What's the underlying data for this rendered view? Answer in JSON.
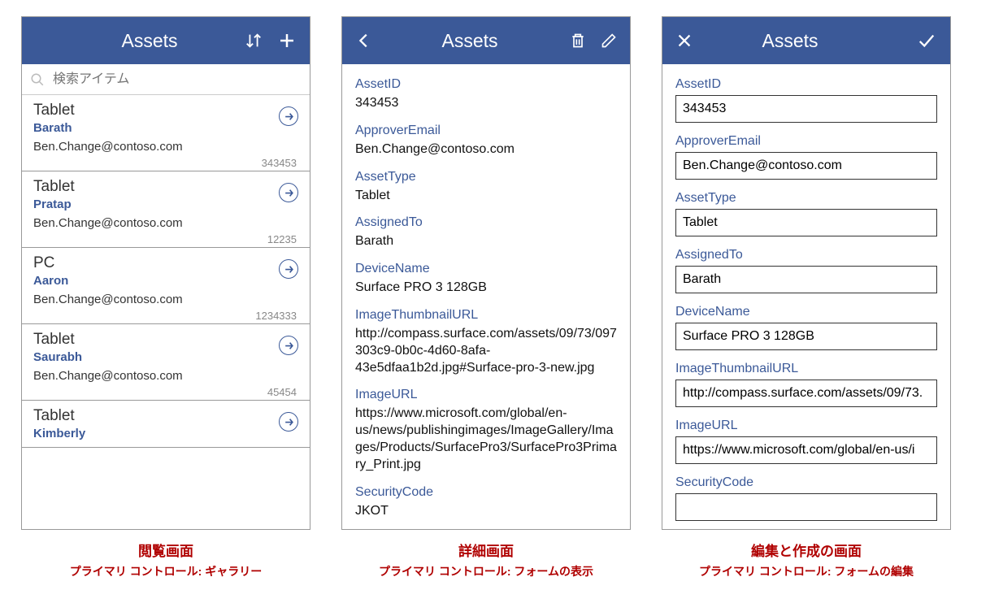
{
  "browse": {
    "header": {
      "title": "Assets"
    },
    "search_placeholder": "検索アイテム",
    "items": [
      {
        "title": "Tablet",
        "assigned": "Barath",
        "email": "Ben.Change@contoso.com",
        "id": "343453"
      },
      {
        "title": "Tablet",
        "assigned": "Pratap",
        "email": "Ben.Change@contoso.com",
        "id": "12235"
      },
      {
        "title": "PC",
        "assigned": "Aaron",
        "email": "Ben.Change@contoso.com",
        "id": "1234333"
      },
      {
        "title": "Tablet",
        "assigned": "Saurabh",
        "email": "Ben.Change@contoso.com",
        "id": "45454"
      },
      {
        "title": "Tablet",
        "assigned": "Kimberly",
        "email": "",
        "id": ""
      }
    ],
    "caption_title": "閲覧画面",
    "caption_sub": "プライマリ コントロール: ギャラリー"
  },
  "detail": {
    "header": {
      "title": "Assets"
    },
    "fields": [
      {
        "label": "AssetID",
        "value": "343453"
      },
      {
        "label": "ApproverEmail",
        "value": "Ben.Change@contoso.com"
      },
      {
        "label": "AssetType",
        "value": "Tablet"
      },
      {
        "label": "AssignedTo",
        "value": "Barath"
      },
      {
        "label": "DeviceName",
        "value": "Surface PRO 3 128GB"
      },
      {
        "label": "ImageThumbnailURL",
        "value": "http://compass.surface.com/assets/09/73/097303c9-0b0c-4d60-8afa-43e5dfaa1b2d.jpg#Surface-pro-3-new.jpg"
      },
      {
        "label": "ImageURL",
        "value": "https://www.microsoft.com/global/en-us/news/publishingimages/ImageGallery/Images/Products/SurfacePro3/SurfacePro3Primary_Print.jpg"
      },
      {
        "label": "SecurityCode",
        "value": "JKOT"
      }
    ],
    "caption_title": "詳細画面",
    "caption_sub": "プライマリ コントロール: フォームの表示"
  },
  "edit": {
    "header": {
      "title": "Assets"
    },
    "fields": [
      {
        "label": "AssetID",
        "value": "343453"
      },
      {
        "label": "ApproverEmail",
        "value": "Ben.Change@contoso.com"
      },
      {
        "label": "AssetType",
        "value": "Tablet"
      },
      {
        "label": "AssignedTo",
        "value": "Barath"
      },
      {
        "label": "DeviceName",
        "value": "Surface PRO 3 128GB"
      },
      {
        "label": "ImageThumbnailURL",
        "value": "http://compass.surface.com/assets/09/73."
      },
      {
        "label": "ImageURL",
        "value": "https://www.microsoft.com/global/en-us/i"
      },
      {
        "label": "SecurityCode",
        "value": ""
      }
    ],
    "caption_title": "編集と作成の画面",
    "caption_sub": "プライマリ コントロール: フォームの編集"
  }
}
